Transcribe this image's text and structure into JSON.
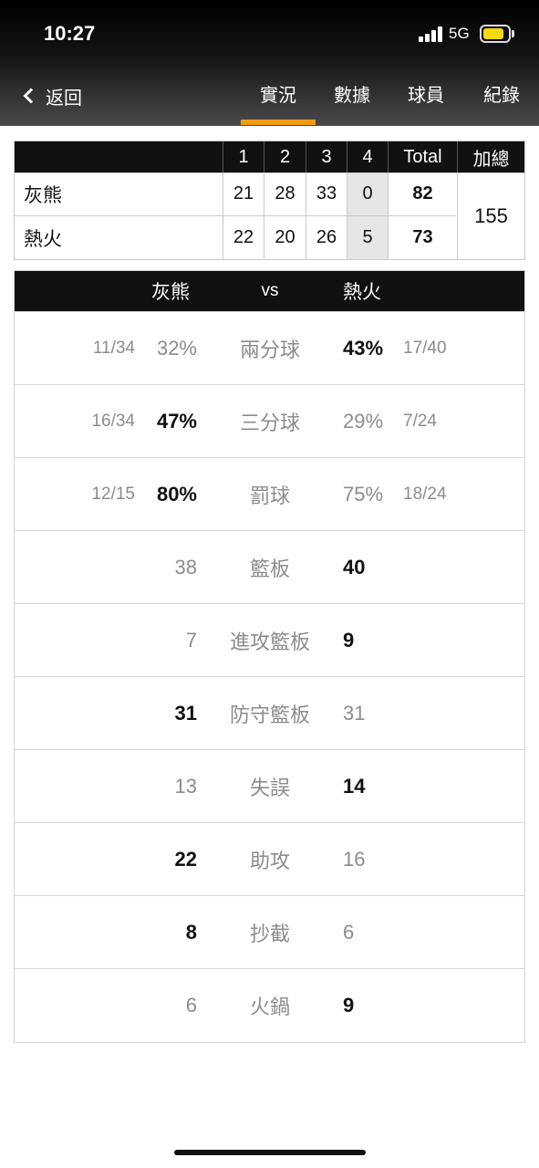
{
  "status_bar": {
    "time": "10:27",
    "network": "5G"
  },
  "nav": {
    "back_label": "返回",
    "tabs": [
      "實況",
      "數據",
      "球員",
      "紀錄"
    ],
    "active_tab": "實況"
  },
  "score": {
    "headers": [
      "1",
      "2",
      "3",
      "4",
      "Total",
      "加總"
    ],
    "teams": [
      {
        "name": "灰熊",
        "q1": "21",
        "q2": "28",
        "q3": "33",
        "q4": "0",
        "total": "82"
      },
      {
        "name": "熱火",
        "q1": "22",
        "q2": "20",
        "q3": "26",
        "q4": "5",
        "total": "73"
      }
    ],
    "combined": "155"
  },
  "stats": {
    "home": "灰熊",
    "vs": "vs",
    "away": "熱火",
    "rows": [
      {
        "label": "兩分球",
        "home_frac": "11/34",
        "home": "32%",
        "away": "43%",
        "away_frac": "17/40",
        "winner": "away"
      },
      {
        "label": "三分球",
        "home_frac": "16/34",
        "home": "47%",
        "away": "29%",
        "away_frac": "7/24",
        "winner": "home"
      },
      {
        "label": "罰球",
        "home_frac": "12/15",
        "home": "80%",
        "away": "75%",
        "away_frac": "18/24",
        "winner": "home"
      },
      {
        "label": "籃板",
        "home": "38",
        "away": "40",
        "winner": "away"
      },
      {
        "label": "進攻籃板",
        "home": "7",
        "away": "9",
        "winner": "away"
      },
      {
        "label": "防守籃板",
        "home": "31",
        "away": "31",
        "winner": "home"
      },
      {
        "label": "失誤",
        "home": "13",
        "away": "14",
        "winner": "away"
      },
      {
        "label": "助攻",
        "home": "22",
        "away": "16",
        "winner": "home"
      },
      {
        "label": "抄截",
        "home": "8",
        "away": "6",
        "winner": "home"
      },
      {
        "label": "火鍋",
        "home": "6",
        "away": "9",
        "winner": "away"
      }
    ]
  },
  "colors": {
    "accent": "#f39c12",
    "header_bg": "#111111",
    "muted": "#8c8c8c"
  }
}
